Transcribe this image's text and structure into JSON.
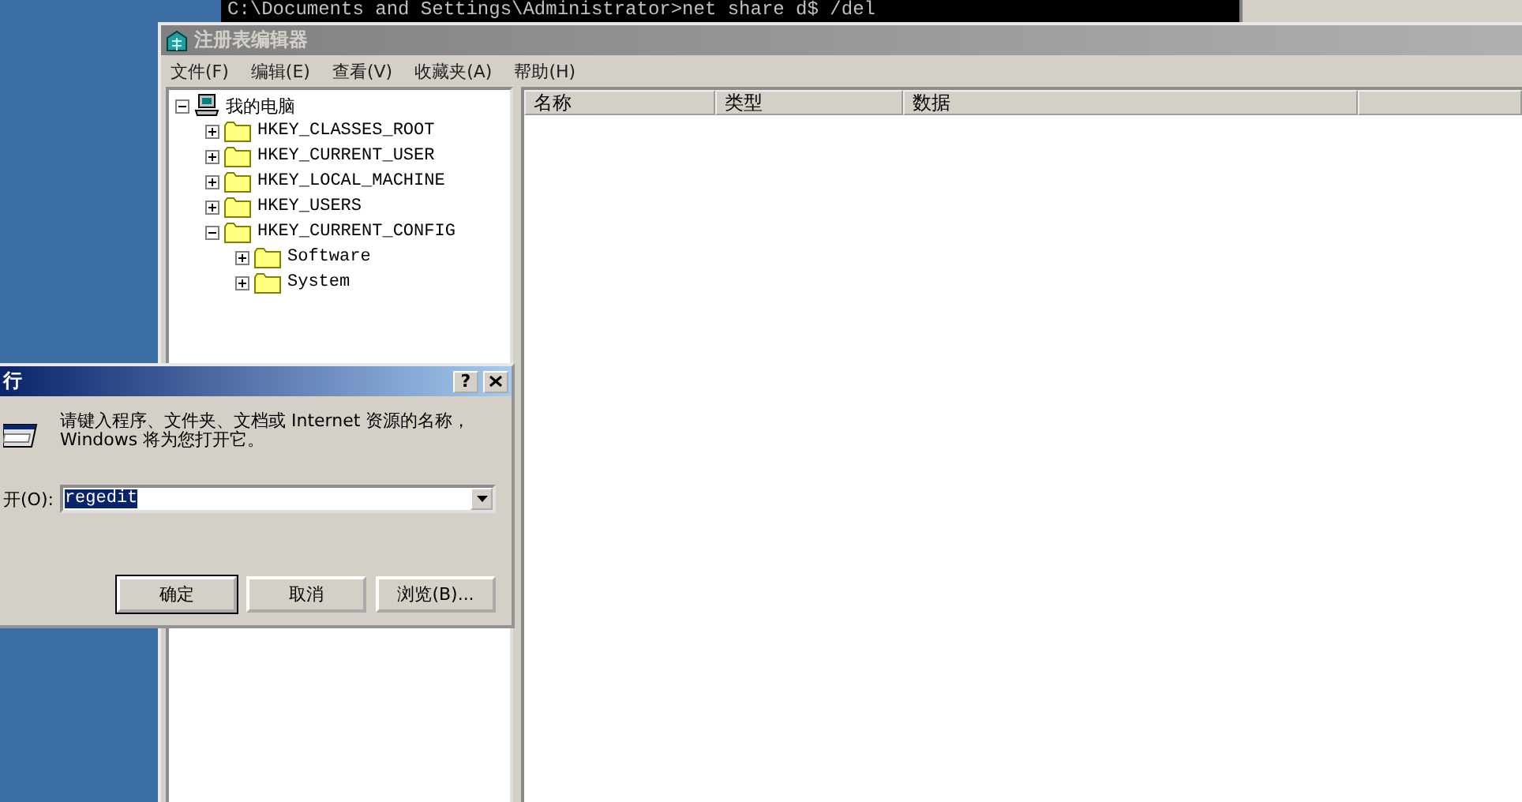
{
  "console": {
    "lines": [
      "C:\\Documents and Settings\\Administrator>net share d$ /del"
    ]
  },
  "regedit": {
    "title": "注册表编辑器",
    "active": false,
    "menu": [
      "文件(F)",
      "编辑(E)",
      "查看(V)",
      "收藏夹(A)",
      "帮助(H)"
    ],
    "tree": {
      "label": "我的电脑",
      "kind": "computer",
      "expanded": true,
      "children": [
        {
          "label": "HKEY_CLASSES_ROOT",
          "kind": "folder",
          "expanded": false
        },
        {
          "label": "HKEY_CURRENT_USER",
          "kind": "folder",
          "expanded": false
        },
        {
          "label": "HKEY_LOCAL_MACHINE",
          "kind": "folder",
          "expanded": false
        },
        {
          "label": "HKEY_USERS",
          "kind": "folder",
          "expanded": false
        },
        {
          "label": "HKEY_CURRENT_CONFIG",
          "kind": "folder",
          "expanded": true,
          "children": [
            {
              "label": "Software",
              "kind": "folder",
              "expanded": false
            },
            {
              "label": "System",
              "kind": "folder",
              "expanded": false
            }
          ]
        }
      ]
    },
    "columns": [
      "名称",
      "类型",
      "数据"
    ]
  },
  "run_dialog": {
    "title": "行",
    "active": true,
    "help_button": "?",
    "description": "请键入程序、文件夹、文档或 Internet 资源的名称，Windows 将为您打开它。",
    "open_label": "开(O):",
    "value": "regedit",
    "buttons": [
      "确定",
      "取消",
      "浏览(B)..."
    ]
  }
}
